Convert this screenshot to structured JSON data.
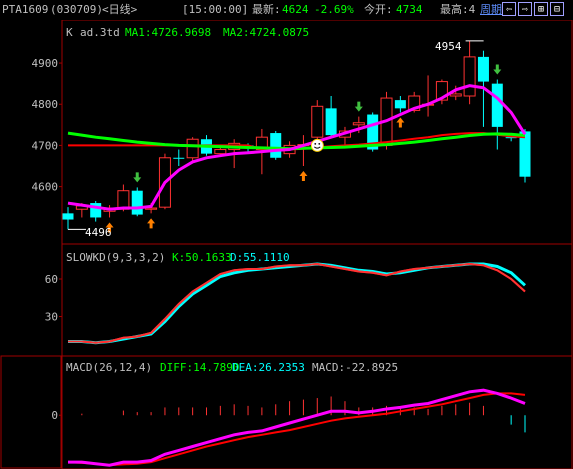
{
  "header": {
    "symbol": "PTA1609",
    "code": "(030709)",
    "period_tag": "<日线>",
    "time": "[15:00:00]",
    "latest_label": "最新:",
    "latest_value": "4624",
    "change_pct": "-2.69%",
    "open_label": "今开:",
    "open_value": "4734",
    "high_label": "最高:4",
    "period_button": "周期",
    "buttons": [
      "prev-icon",
      "next-icon",
      "zoom-in-icon",
      "zoom-out-icon"
    ]
  },
  "main_panel": {
    "prefix": "K",
    "name": "ad.3td",
    "ma1": "MA1:4726.9698",
    "ma2": "MA2:4724.0875",
    "max_label": "4954",
    "min_label": "4496",
    "y_ticks": [
      "4900",
      "4800",
      "4700",
      "4600"
    ]
  },
  "kd_panel": {
    "name": "SLOWKD(9,3,3,2)",
    "k": "K:50.1633",
    "d": "D:55.1110",
    "y_ticks": [
      "60",
      "30"
    ]
  },
  "macd_panel": {
    "name": "MACD(26,12,4)",
    "diff": "DIFF:14.7890",
    "dea": "DEA:26.2353",
    "macd": "MACD:-22.8925",
    "y_ticks": [
      "0"
    ]
  },
  "colors": {
    "up": "#ff3232",
    "down": "#00ffff",
    "ma1": "#ff00ff",
    "ma2": "#00ff00",
    "red_line": "#ff0000",
    "axis": "#a00000",
    "text_yellow": "#ffff00",
    "text_green": "#00ff00",
    "text_cyan": "#00ffff"
  },
  "chart_data": {
    "type": "candlestick",
    "candles": [
      {
        "o": 4535,
        "c": 4520,
        "h": 4550,
        "l": 4496
      },
      {
        "o": 4545,
        "c": 4553,
        "h": 4560,
        "l": 4525
      },
      {
        "o": 4560,
        "c": 4525,
        "h": 4565,
        "l": 4515
      },
      {
        "o": 4540,
        "c": 4548,
        "h": 4555,
        "l": 4525
      },
      {
        "o": 4545,
        "c": 4590,
        "h": 4605,
        "l": 4540
      },
      {
        "o": 4590,
        "c": 4532,
        "h": 4598,
        "l": 4528
      },
      {
        "o": 4545,
        "c": 4548,
        "h": 4560,
        "l": 4535
      },
      {
        "o": 4550,
        "c": 4670,
        "h": 4680,
        "l": 4545
      },
      {
        "o": 4670,
        "c": 4668,
        "h": 4690,
        "l": 4650
      },
      {
        "o": 4670,
        "c": 4715,
        "h": 4720,
        "l": 4660
      },
      {
        "o": 4715,
        "c": 4680,
        "h": 4725,
        "l": 4675
      },
      {
        "o": 4680,
        "c": 4690,
        "h": 4700,
        "l": 4675
      },
      {
        "o": 4690,
        "c": 4705,
        "h": 4715,
        "l": 4645
      },
      {
        "o": 4700,
        "c": 4695,
        "h": 4705,
        "l": 4680
      },
      {
        "o": 4690,
        "c": 4720,
        "h": 4740,
        "l": 4630
      },
      {
        "o": 4730,
        "c": 4670,
        "h": 4735,
        "l": 4665
      },
      {
        "o": 4680,
        "c": 4700,
        "h": 4710,
        "l": 4670
      },
      {
        "o": 4700,
        "c": 4702,
        "h": 4725,
        "l": 4650
      },
      {
        "o": 4720,
        "c": 4795,
        "h": 4810,
        "l": 4710
      },
      {
        "o": 4790,
        "c": 4725,
        "h": 4820,
        "l": 4720
      },
      {
        "o": 4720,
        "c": 4735,
        "h": 4745,
        "l": 4700
      },
      {
        "o": 4750,
        "c": 4755,
        "h": 4770,
        "l": 4730
      },
      {
        "o": 4775,
        "c": 4690,
        "h": 4780,
        "l": 4685
      },
      {
        "o": 4700,
        "c": 4815,
        "h": 4830,
        "l": 4690
      },
      {
        "o": 4810,
        "c": 4790,
        "h": 4820,
        "l": 4780
      },
      {
        "o": 4785,
        "c": 4820,
        "h": 4830,
        "l": 4780
      },
      {
        "o": 4800,
        "c": 4800,
        "h": 4870,
        "l": 4770
      },
      {
        "o": 4810,
        "c": 4855,
        "h": 4860,
        "l": 4800
      },
      {
        "o": 4820,
        "c": 4825,
        "h": 4845,
        "l": 4810
      },
      {
        "o": 4820,
        "c": 4915,
        "h": 4954,
        "l": 4800
      },
      {
        "o": 4915,
        "c": 4855,
        "h": 4930,
        "l": 4745
      },
      {
        "o": 4850,
        "c": 4745,
        "h": 4860,
        "l": 4690
      },
      {
        "o": 4720,
        "c": 4718,
        "h": 4730,
        "l": 4710
      },
      {
        "o": 4734,
        "c": 4624,
        "h": 4740,
        "l": 4610
      }
    ],
    "ma1": [
      4560,
      4555,
      4550,
      4545,
      4548,
      4548,
      4552,
      4610,
      4640,
      4660,
      4670,
      4675,
      4680,
      4682,
      4685,
      4688,
      4690,
      4700,
      4710,
      4720,
      4730,
      4740,
      4750,
      4760,
      4775,
      4790,
      4800,
      4815,
      4835,
      4845,
      4840,
      4815,
      4780,
      4727
    ],
    "ma2": [
      4730,
      4725,
      4720,
      4716,
      4712,
      4708,
      4705,
      4702,
      4700,
      4699,
      4698,
      4697,
      4696,
      4695,
      4694,
      4693,
      4692,
      4693,
      4694,
      4695,
      4696,
      4698,
      4700,
      4702,
      4705,
      4708,
      4712,
      4716,
      4720,
      4724,
      4727,
      4728,
      4727,
      4724
    ],
    "ma3": [
      4700,
      4700,
      4700,
      4700,
      4700,
      4700,
      4700,
      4700,
      4700,
      4700,
      4700,
      4700,
      4700,
      4700,
      4690,
      4688,
      4690,
      4692,
      4695,
      4698,
      4700,
      4702,
      4705,
      4708,
      4712,
      4716,
      4720,
      4725,
      4728,
      4730,
      4730,
      4726,
      4722,
      4720
    ],
    "kd_k": [
      10,
      10,
      9,
      10,
      13,
      14,
      17,
      28,
      40,
      50,
      57,
      64,
      67,
      68,
      68,
      70,
      71,
      71,
      72,
      70,
      68,
      66,
      65,
      63,
      66,
      68,
      69,
      70,
      71,
      72,
      71,
      67,
      60,
      50
    ],
    "kd_d": [
      10,
      10,
      9,
      10,
      12,
      14,
      16,
      26,
      38,
      48,
      55,
      62,
      65,
      67,
      68,
      69,
      70,
      71,
      72,
      71,
      69,
      67,
      66,
      64,
      65,
      67,
      69,
      70,
      71,
      72,
      72,
      70,
      65,
      55
    ],
    "macd_diff": [
      -60,
      -60,
      -62,
      -64,
      -60,
      -60,
      -58,
      -50,
      -45,
      -40,
      -35,
      -30,
      -25,
      -22,
      -20,
      -15,
      -10,
      -5,
      0,
      5,
      5,
      3,
      5,
      8,
      10,
      13,
      15,
      20,
      25,
      30,
      32,
      28,
      22,
      15
    ],
    "macd_dea": [
      -60,
      -61,
      -62,
      -64,
      -63,
      -62,
      -60,
      -55,
      -50,
      -45,
      -40,
      -36,
      -32,
      -28,
      -25,
      -22,
      -19,
      -15,
      -11,
      -7,
      -4,
      -2,
      0,
      2,
      5,
      8,
      11,
      14,
      18,
      22,
      26,
      28,
      28,
      26
    ],
    "kd_ylim": [
      0,
      80
    ],
    "macd_ylim": [
      -65,
      40
    ],
    "price_ylim": [
      4480,
      4990
    ]
  }
}
